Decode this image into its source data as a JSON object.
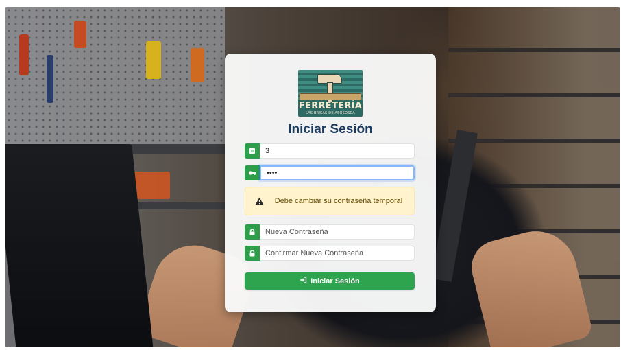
{
  "logo": {
    "brand": "FERRETERÍA",
    "tagline": "LAS BRISAS DE ASOSOSCA"
  },
  "login": {
    "title": "Iniciar Sesión",
    "user_value": "3",
    "password_value": "••••",
    "alert_message": "Debe cambiar su contraseña temporal",
    "new_password_placeholder": "Nueva Contraseña",
    "confirm_password_placeholder": "Confirmar Nueva Contraseña",
    "submit_label": "Iniciar Sesión"
  },
  "icons": {
    "user_field": "id-card-icon",
    "password_field": "key-icon",
    "alert": "warning-triangle-icon",
    "new_password": "lock-icon",
    "confirm_password": "lock-icon",
    "submit": "sign-in-icon"
  },
  "colors": {
    "accent": "#2e9e4a",
    "title": "#1b3a5c",
    "alert_bg": "#fff3cd",
    "alert_text": "#664d03"
  }
}
